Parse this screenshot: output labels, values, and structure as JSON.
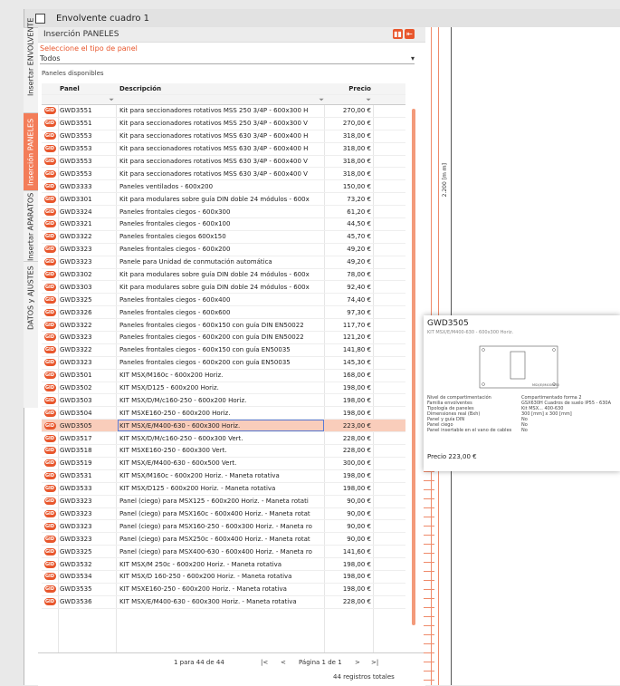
{
  "window": {
    "title": "Envolvente cuadro 1"
  },
  "vertical_tabs": [
    {
      "label": "Insertar ENVOLVENTE",
      "active": false
    },
    {
      "label": "Inserción PANELES",
      "active": true
    },
    {
      "label": "Insertar APARATOS",
      "active": false
    },
    {
      "label": "DATOS y AJUSTES",
      "active": false
    }
  ],
  "panel": {
    "title": "Inserción PANELES",
    "select_label": "Seleccione el tipo de panel",
    "select_value": "Todos",
    "available_label": "Paneles disponibles"
  },
  "table": {
    "headers": {
      "panel": "Panel",
      "desc": "Descripción",
      "price": "Precio"
    },
    "icon_text": "GID",
    "rows": [
      {
        "code": "GWD3551",
        "desc": "Kit para seccionadores rotativos MSS 250 3/4P - 600x300 H",
        "price": "270,00 €"
      },
      {
        "code": "GWD3551",
        "desc": "Kit para seccionadores rotativos MSS 250 3/4P - 600x300 V",
        "price": "270,00 €"
      },
      {
        "code": "GWD3553",
        "desc": "Kit para seccionadores rotativos MSS 630 3/4P - 600x400 H",
        "price": "318,00 €"
      },
      {
        "code": "GWD3553",
        "desc": "Kit para seccionadores rotativos MSS 630 3/4P - 600x400 H",
        "price": "318,00 €"
      },
      {
        "code": "GWD3553",
        "desc": "Kit para seccionadores rotativos MSS 630 3/4P - 600x400 V",
        "price": "318,00 €"
      },
      {
        "code": "GWD3553",
        "desc": "Kit para seccionadores rotativos MSS 630 3/4P - 600x400 V",
        "price": "318,00 €"
      },
      {
        "code": "GWD3333",
        "desc": "Paneles ventilados - 600x200",
        "price": "150,00 €"
      },
      {
        "code": "GWD3301",
        "desc": "Kit para modulares sobre guía DIN doble 24 módulos - 600x",
        "price": "73,20 €"
      },
      {
        "code": "GWD3324",
        "desc": "Paneles frontales ciegos - 600x300",
        "price": "61,20 €"
      },
      {
        "code": "GWD3321",
        "desc": "Paneles frontales ciegos - 600x100",
        "price": "44,50 €"
      },
      {
        "code": "GWD3322",
        "desc": "Paneles frontales ciegos 600x150",
        "price": "45,70 €"
      },
      {
        "code": "GWD3323",
        "desc": "Paneles frontales ciegos - 600x200",
        "price": "49,20 €"
      },
      {
        "code": "GWD3323",
        "desc": "Panele para Unidad de conmutación automática",
        "price": "49,20 €"
      },
      {
        "code": "GWD3302",
        "desc": "Kit para modulares sobre guía DIN doble 24 módulos - 600x",
        "price": "78,00 €"
      },
      {
        "code": "GWD3303",
        "desc": "Kit para modulares sobre guía DIN doble 24 módulos - 600x",
        "price": "92,40 €"
      },
      {
        "code": "GWD3325",
        "desc": "Paneles frontales ciegos - 600x400",
        "price": "74,40 €"
      },
      {
        "code": "GWD3326",
        "desc": "Paneles frontales ciegos - 600x600",
        "price": "97,30 €"
      },
      {
        "code": "GWD3322",
        "desc": "Paneles frontales ciegos - 600x150 con guía DIN EN50022",
        "price": "117,70 €"
      },
      {
        "code": "GWD3323",
        "desc": "Paneles frontales ciegos - 600x200 con guía DIN EN50022",
        "price": "121,20 €"
      },
      {
        "code": "GWD3322",
        "desc": "Paneles frontales ciegos - 600x150 con guía EN50035",
        "price": "141,80 €"
      },
      {
        "code": "GWD3323",
        "desc": "Paneles frontales ciegos - 600x200 con guía EN50035",
        "price": "145,30 €"
      },
      {
        "code": "GWD3501",
        "desc": "KIT MSX/M160c - 600x200 Horiz.",
        "price": "168,00 €"
      },
      {
        "code": "GWD3502",
        "desc": "KIT MSX/D125 - 600x200 Horiz.",
        "price": "198,00 €"
      },
      {
        "code": "GWD3503",
        "desc": "KIT MSX/D/M/c160-250 - 600x200 Horiz.",
        "price": "198,00 €"
      },
      {
        "code": "GWD3504",
        "desc": "KIT MSXE160-250 - 600x200 Horiz.",
        "price": "198,00 €"
      },
      {
        "code": "GWD3505",
        "desc": "KIT MSX/E/M400-630 - 600x300 Horiz.",
        "price": "223,00 €",
        "selected": true
      },
      {
        "code": "GWD3517",
        "desc": "KIT MSX/D/M/c160-250 - 600x300 Vert.",
        "price": "228,00 €"
      },
      {
        "code": "GWD3518",
        "desc": "KIT MSXE160-250 - 600x300 Vert.",
        "price": "228,00 €"
      },
      {
        "code": "GWD3519",
        "desc": "KIT MSX/E/M400-630 - 600x500 Vert.",
        "price": "300,00 €"
      },
      {
        "code": "GWD3531",
        "desc": "KIT MSX/M160c - 600x200 Horiz. - Maneta rotativa",
        "price": "198,00 €"
      },
      {
        "code": "GWD3533",
        "desc": "KIT MSX/D125 - 600x200 Horiz. - Maneta rotativa",
        "price": "198,00 €"
      },
      {
        "code": "GWD3323",
        "desc": "Panel (ciego) para MSX125 - 600x200 Horiz. - Maneta rotati",
        "price": "90,00 €"
      },
      {
        "code": "GWD3323",
        "desc": "Panel (ciego) para MSX160c - 600x400 Horiz. - Maneta rotat",
        "price": "90,00 €"
      },
      {
        "code": "GWD3323",
        "desc": "Panel (ciego) para MSX160-250 - 600x300 Horiz. - Maneta ro",
        "price": "90,00 €"
      },
      {
        "code": "GWD3323",
        "desc": "Panel (ciego) para MSX250c - 600x400 Horiz. - Maneta rotat",
        "price": "90,00 €"
      },
      {
        "code": "GWD3325",
        "desc": "Panel (ciego) para MSX400-630 - 600x400 Horiz. - Maneta ro",
        "price": "141,60 €"
      },
      {
        "code": "GWD3532",
        "desc": "KIT MSX/M 250c - 600x200 Horiz. - Maneta rotativa",
        "price": "198,00 €"
      },
      {
        "code": "GWD3534",
        "desc": "KIT MSX/D 160-250 - 600x200 Horiz. - Maneta rotativa",
        "price": "198,00 €"
      },
      {
        "code": "GWD3535",
        "desc": "KIT MSXE160-250 - 600x200 Horiz. - Maneta rotativa",
        "price": "198,00 €"
      },
      {
        "code": "GWD3536",
        "desc": "KIT MSX/E/M400-630 - 600x300 Horiz. - Maneta rotativa",
        "price": "228,00 €"
      }
    ]
  },
  "pager": {
    "range": "1 para 44 de 44",
    "page": "Página 1 de 1",
    "total": "44 registros totales"
  },
  "drawing": {
    "dimension_label": "2.200 [m m]"
  },
  "tooltip": {
    "title": "GWD3505",
    "subtitle": "KIT MSX/E/M400-630 - 600x300 Horiz.",
    "drawing_tag": "MSX/E/M400-630",
    "specs": [
      {
        "k": "Nivel de compartimentación",
        "v": "Compartimentado forma 2"
      },
      {
        "k": "Familia envolventes",
        "v": "GSX630H Cuadros de suelo IP55 - 630A"
      },
      {
        "k": "Tipología de paneles",
        "v": "Kit MSX... 400-630"
      },
      {
        "k": "Dimensiones real (Bxh)",
        "v": "300 [mm] x 300 [mm]"
      },
      {
        "k": "Panel y guía DIN",
        "v": "No"
      },
      {
        "k": "Panel ciego",
        "v": "No"
      },
      {
        "k": "Panel insertable en el vano de cables",
        "v": "No"
      }
    ],
    "price": "Precio  223,00 €"
  },
  "colors": {
    "accent": "#e8562c",
    "selected_row": "#f9cdbb",
    "tab_active": "#f37d59"
  }
}
